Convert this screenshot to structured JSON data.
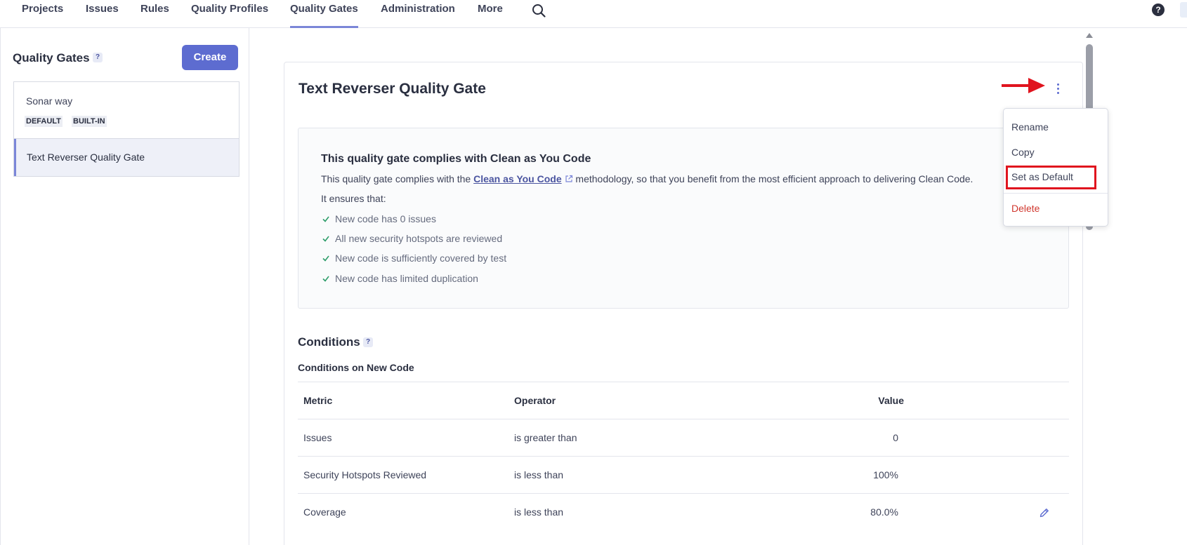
{
  "nav": {
    "items": [
      "Projects",
      "Issues",
      "Rules",
      "Quality Profiles",
      "Quality Gates",
      "Administration",
      "More"
    ],
    "help": "?"
  },
  "sidebar": {
    "title": "Quality Gates",
    "help": "?",
    "create_label": "Create",
    "gates": [
      {
        "name": "Sonar way",
        "badges": [
          "DEFAULT",
          "BUILT-IN"
        ]
      },
      {
        "name": "Text Reverser Quality Gate"
      }
    ]
  },
  "main": {
    "title": "Text Reverser Quality Gate",
    "cayc": {
      "title": "This quality gate complies with Clean as You Code",
      "text_before": "This quality gate complies with the ",
      "link": "Clean as You Code",
      "text_after": " methodology, so that you benefit from the most efficient approach to delivering Clean Code.",
      "ensures": "It ensures that:",
      "checks": [
        "New code has 0 issues",
        "All new security hotspots are reviewed",
        "New code is sufficiently covered by test",
        "New code has limited duplication"
      ]
    },
    "conditions": {
      "title": "Conditions",
      "help": "?",
      "subtitle": "Conditions on New Code",
      "headers": {
        "metric": "Metric",
        "operator": "Operator",
        "value": "Value"
      },
      "rows": [
        {
          "metric": "Issues",
          "operator": "is greater than",
          "value": "0"
        },
        {
          "metric": "Security Hotspots Reviewed",
          "operator": "is less than",
          "value": "100%"
        },
        {
          "metric": "Coverage",
          "operator": "is less than",
          "value": "80.0%"
        }
      ]
    }
  },
  "menu": {
    "rename": "Rename",
    "copy": "Copy",
    "set_default": "Set as Default",
    "delete": "Delete"
  },
  "colors": {
    "accent": "#5d6cd0",
    "highlight": "#e0141e",
    "danger": "#d0372e",
    "check": "#2e9e6a"
  }
}
